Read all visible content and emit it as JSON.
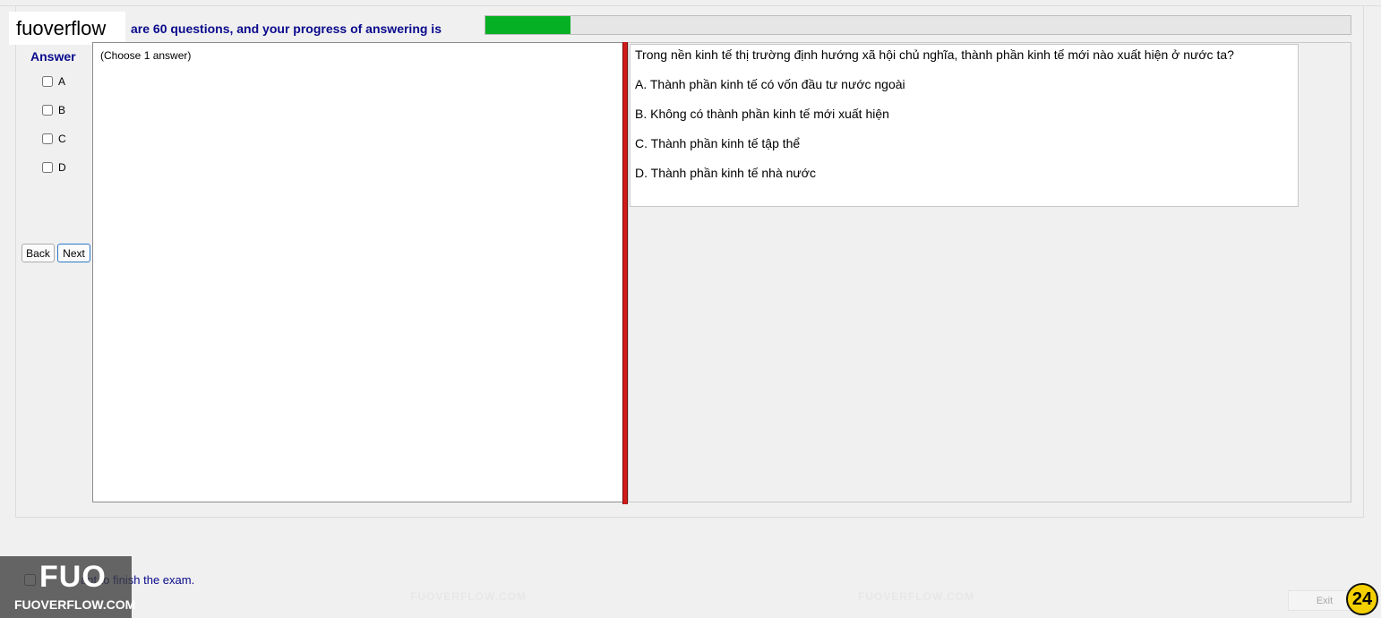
{
  "header": {
    "logo_text": "fuoverflow",
    "progress_text": "are 60 questions, and your progress of answering is",
    "progress_fraction": 0.098
  },
  "answer_panel": {
    "title": "Answer",
    "choices": [
      "A",
      "B",
      "C",
      "D"
    ],
    "back_label": "Back",
    "next_label": "Next"
  },
  "left_panel": {
    "hint": "(Choose 1 answer)"
  },
  "question": {
    "text": "Trong nền kinh tế thị trường định hướng xã hội chủ nghĩa, thành phần kinh tế mới nào xuất hiện ở nước ta?",
    "options": [
      "A.  Thành phần kinh tế có vốn đầu tư nước ngoài",
      "B.  Không có thành phần kinh tế mới xuất hiện",
      "C.  Thành phần kinh tế tập thể",
      "D.  Thành phần kinh tế nhà nước"
    ]
  },
  "footer": {
    "finish_text_visible": "ant to finish the exam.",
    "exit_label": "Exit",
    "badge_number": "24",
    "watermark_big": "FUO",
    "watermark_small": "FUOVERFLOW.COM"
  },
  "colors": {
    "progress_fill": "#06b025",
    "label_blue": "#0a0a8c",
    "divider_red": "#d11a1a",
    "badge_yellow": "#f5d000"
  }
}
